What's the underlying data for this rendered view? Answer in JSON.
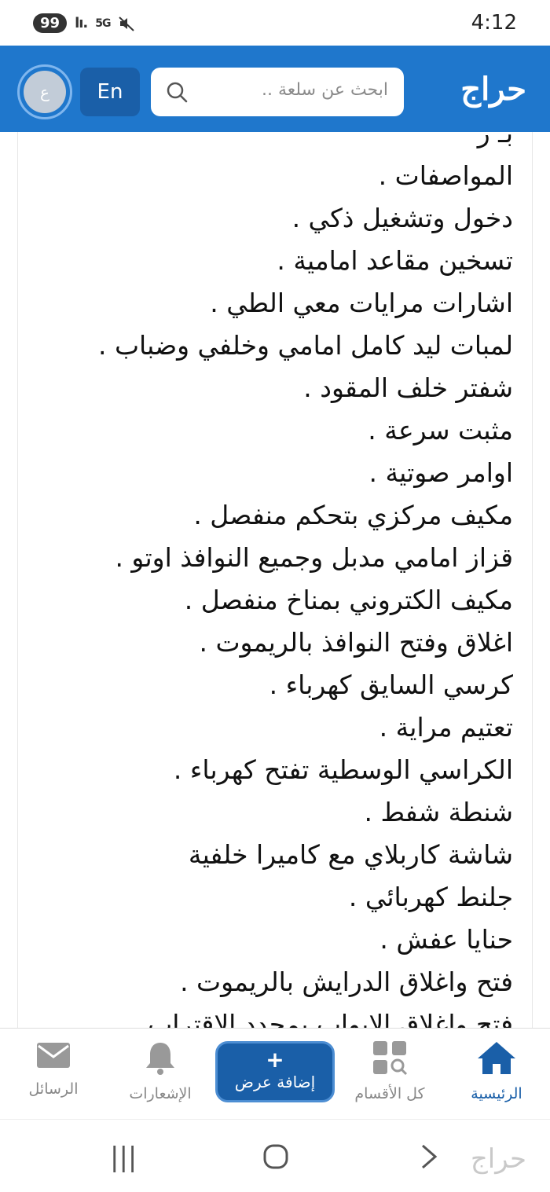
{
  "status_bar": {
    "notification_count": "99",
    "signal": "lı.",
    "network": "5G",
    "time": "4:12"
  },
  "header": {
    "avatar_initial": "ع",
    "lang_button": "En",
    "search_placeholder": "ابحث عن سلعة ..",
    "logo": "حراج",
    "accent_color": "#1f77cc"
  },
  "content": {
    "lines": [
      "بـ ر",
      "المواصفات .",
      "دخول وتشغيل ذكي .",
      "تسخين مقاعد امامية .",
      "اشارات مرايات معي الطي .",
      "لمبات ليد كامل امامي وخلفي وضباب .",
      "شفتر خلف المقود .",
      "مثبت سرعة .",
      "اوامر صوتية .",
      "مكيف مركزي بتحكم منفصل .",
      "قزاز امامي مدبل وجميع النوافذ اوتو .",
      "مكيف الكتروني بمناخ منفصل .",
      "اغلاق وفتح النوافذ بالريموت .",
      "كرسي السايق كهرباء .",
      "تعتيم مراية .",
      "الكراسي الوسطية تفتح كهرباء .",
      "شنطة شفط .",
      "شاشة كاربلاي مع كاميرا خلفية",
      "جلنط كهربائي .",
      "حنايا عفش .",
      "فتح واغلاق الدرايش بالريموت .",
      "فتح واغلاق الابواب بمحدد الاقتراب"
    ]
  },
  "bottom_nav": {
    "home": "الرئيسية",
    "categories": "كل الأقسام",
    "add_offer": "إضافة عرض",
    "notifications": "الإشعارات",
    "messages": "الرسائل"
  },
  "watermark": "حراج"
}
